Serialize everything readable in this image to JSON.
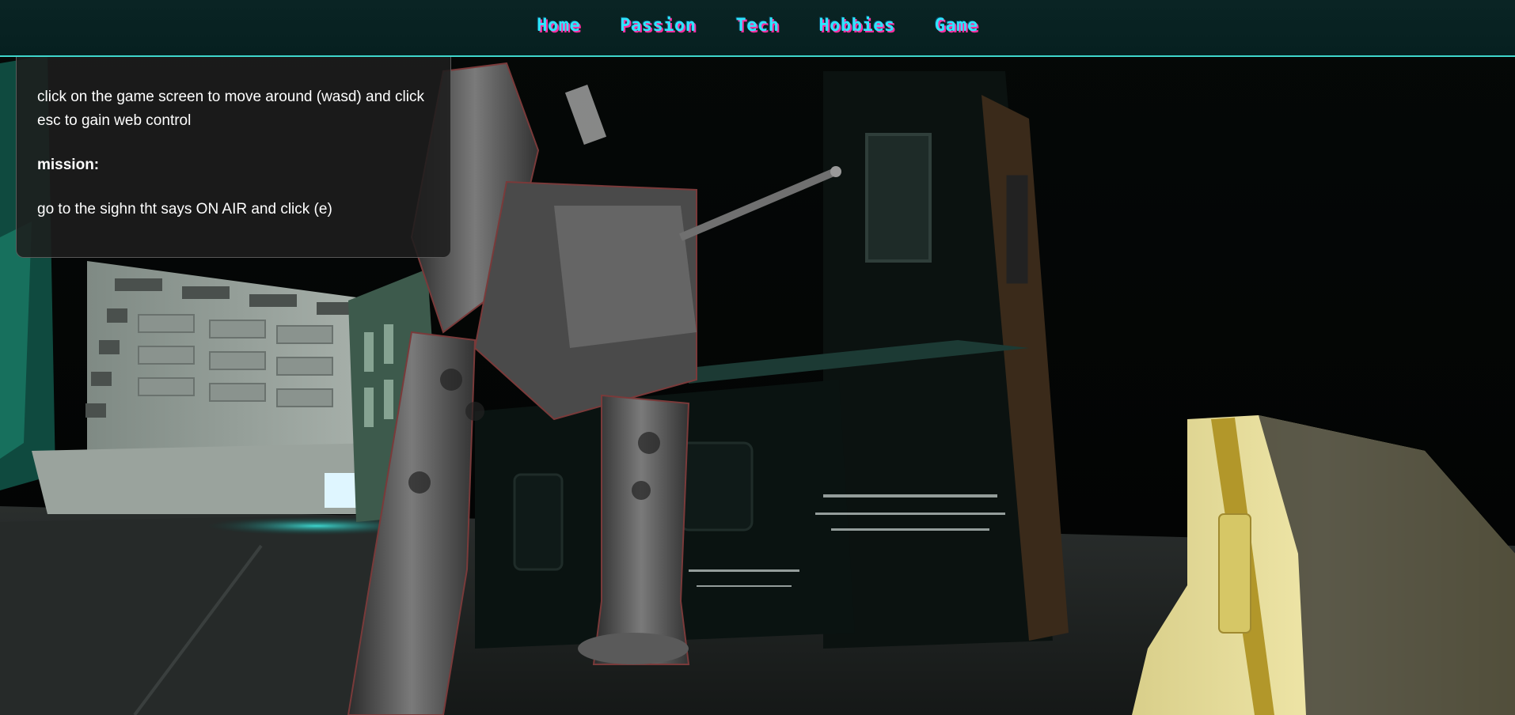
{
  "nav": {
    "items": [
      {
        "label": "Home"
      },
      {
        "label": "Passion"
      },
      {
        "label": "Tech"
      },
      {
        "label": "Hobbies"
      },
      {
        "label": "Game"
      }
    ]
  },
  "info_panel": {
    "instructions": "click on the game screen to move around (wasd) and click esc to gain web control",
    "mission_heading": "mission:",
    "mission_text": "go to the sighn tht says ON AIR and click (e)"
  },
  "colors": {
    "nav_background": "#062020",
    "nav_border": "#3fd6cc",
    "nav_link": "#2ee6ff",
    "nav_link_shadow": "#ff2fa0",
    "panel_background": "#1e1e1e"
  },
  "icons": [
    "robot-mech",
    "barrier"
  ]
}
